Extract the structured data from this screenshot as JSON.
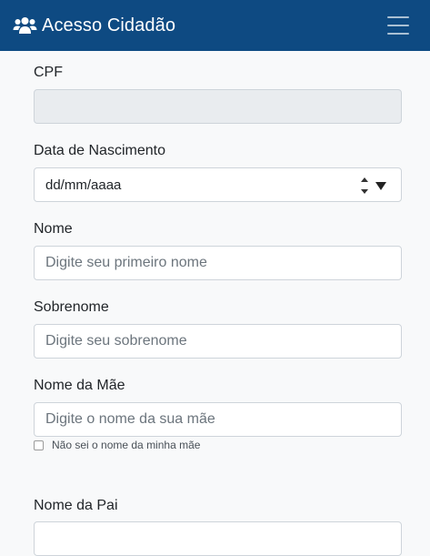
{
  "header": {
    "title": "Acesso Cidadão",
    "icon": "users-icon",
    "background": "#0e4a82"
  },
  "form": {
    "cpf": {
      "label": "CPF",
      "value": ""
    },
    "birth_date": {
      "label": "Data de Nascimento",
      "value": "dd/mm/aaaa"
    },
    "first_name": {
      "label": "Nome",
      "placeholder": "Digite seu primeiro nome"
    },
    "last_name": {
      "label": "Sobrenome",
      "placeholder": "Digite seu sobrenome"
    },
    "mother_name": {
      "label": "Nome da Mãe",
      "placeholder": "Digite o nome da sua mãe",
      "unknown_checkbox_label": "Não sei o nome da minha mãe",
      "unknown_checked": false
    },
    "father_name": {
      "label": "Nome da Pai"
    }
  }
}
